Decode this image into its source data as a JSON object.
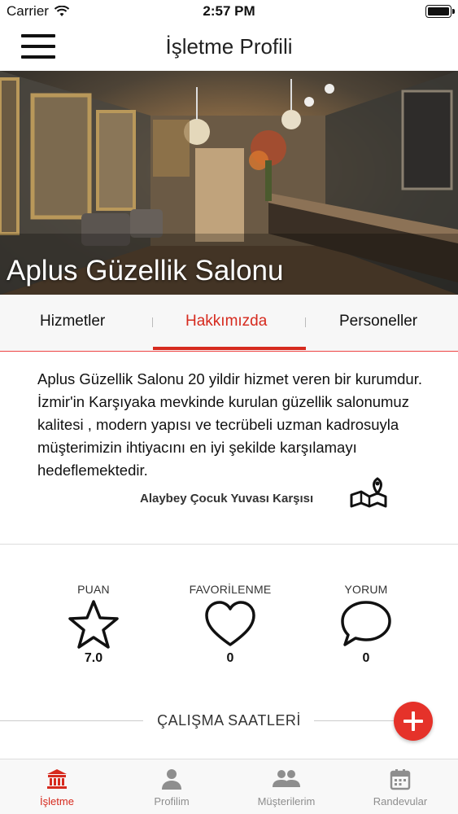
{
  "status_bar": {
    "carrier": "Carrier",
    "time": "2:57 PM"
  },
  "navbar": {
    "title": "İşletme Profili"
  },
  "hero": {
    "business_name": "Aplus Güzellik Salonu"
  },
  "tabs": [
    {
      "label": "Hizmetler"
    },
    {
      "label": "Hakkımızda",
      "active": true
    },
    {
      "label": "Personeller"
    }
  ],
  "about": {
    "description": "Aplus Güzellik Salonu 20 yildir hizmet veren bir kurumdur. İzmir'in Karşıyaka mevkinde kurulan güzellik salonumuz kalitesi , modern yapısı ve tecrübeli uzman kadrosuyla müşterimizin ihtiyacını en iyi şekilde karşılamayı hedeflemektedir.",
    "address": "Alaybey Çocuk Yuvası Karşısı",
    "map_icon": "map-pin-icon"
  },
  "stats": {
    "rating": {
      "label": "PUAN",
      "value": "7.0",
      "icon": "star-icon"
    },
    "favorites": {
      "label": "FAVORİLENME",
      "value": "0",
      "icon": "heart-icon"
    },
    "comments": {
      "label": "YORUM",
      "value": "0",
      "icon": "speech-bubble-icon"
    }
  },
  "working_hours": {
    "title": "ÇALIŞMA SAATLERİ",
    "add_icon": "plus-icon"
  },
  "tabbar": [
    {
      "label": "İşletme",
      "icon": "building-icon",
      "active": true
    },
    {
      "label": "Profilim",
      "icon": "person-icon"
    },
    {
      "label": "Müşterilerim",
      "icon": "people-icon"
    },
    {
      "label": "Randevular",
      "icon": "calendar-icon"
    }
  ],
  "colors": {
    "accent": "#d62a1e",
    "fab": "#e5322a",
    "inactive": "#8e8e8e"
  }
}
